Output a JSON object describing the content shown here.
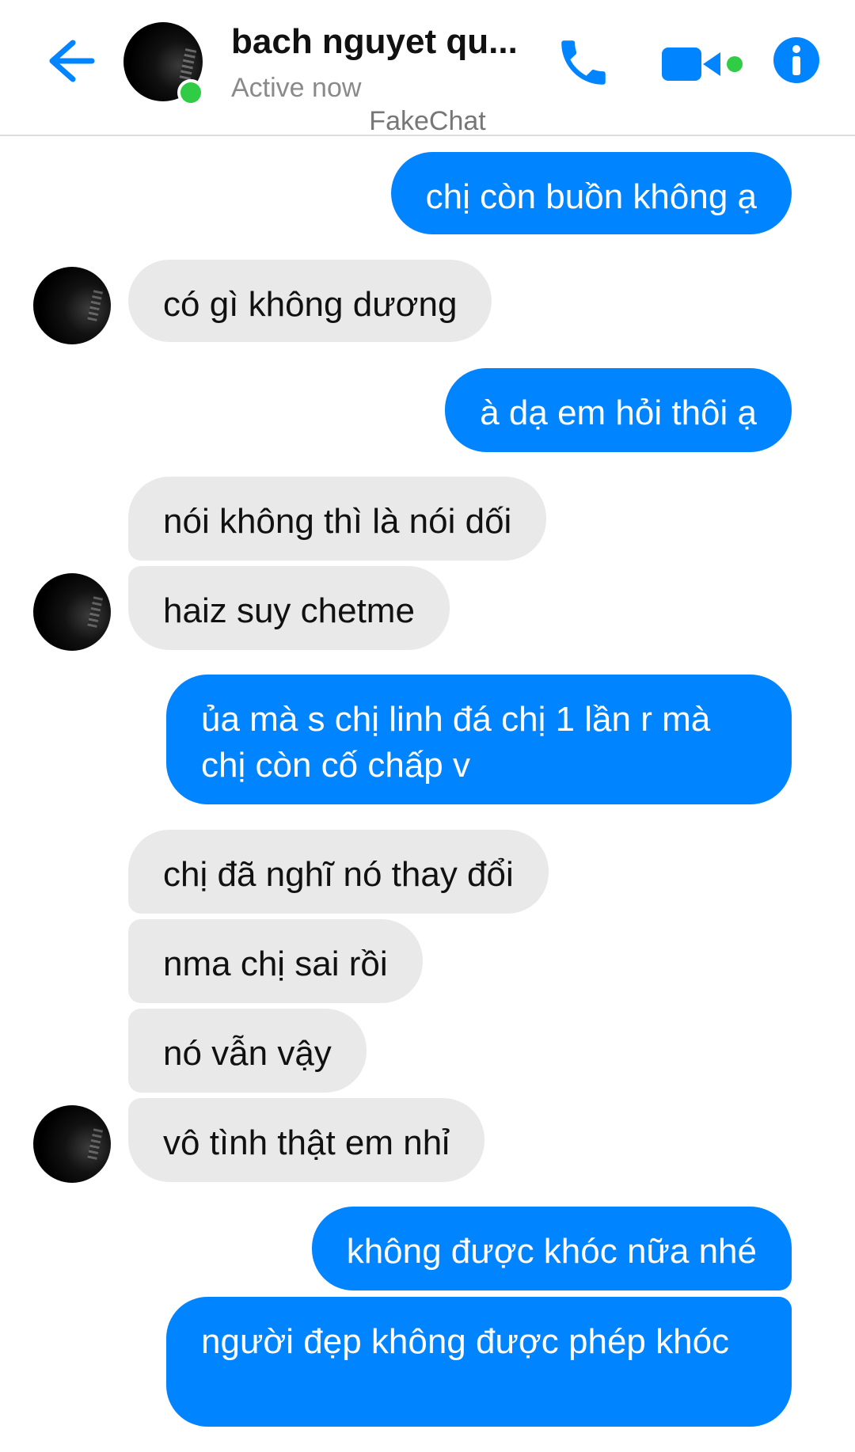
{
  "header": {
    "contact_name": "bach nguyet qu...",
    "status": "Active now",
    "watermark": "FakeChat",
    "icons": [
      "back-arrow-icon",
      "phone-icon",
      "video-camera-icon",
      "info-icon"
    ],
    "accent_color": "#0084ff",
    "online_color": "#31cc46"
  },
  "messages": [
    {
      "from": "me",
      "text": "chị còn buồn không ạ"
    },
    {
      "from": "them",
      "text": "có gì không dương"
    },
    {
      "from": "me",
      "text": "à dạ em hỏi thôi ạ"
    },
    {
      "from": "them",
      "text": "nói không thì là nói dối"
    },
    {
      "from": "them",
      "text": "haiz suy chetme"
    },
    {
      "from": "me",
      "text": "ủa mà s chị linh đá chị 1 lần r mà chị còn cố chấp v"
    },
    {
      "from": "them",
      "text": "chị đã nghĩ nó thay đổi"
    },
    {
      "from": "them",
      "text": "nma chị sai rồi"
    },
    {
      "from": "them",
      "text": "nó vẫn vậy"
    },
    {
      "from": "them",
      "text": "vô tình thật em nhỉ"
    },
    {
      "from": "me",
      "text": "không được khóc nữa nhé"
    },
    {
      "from": "me",
      "text": "người đẹp không được phép khóc"
    }
  ]
}
